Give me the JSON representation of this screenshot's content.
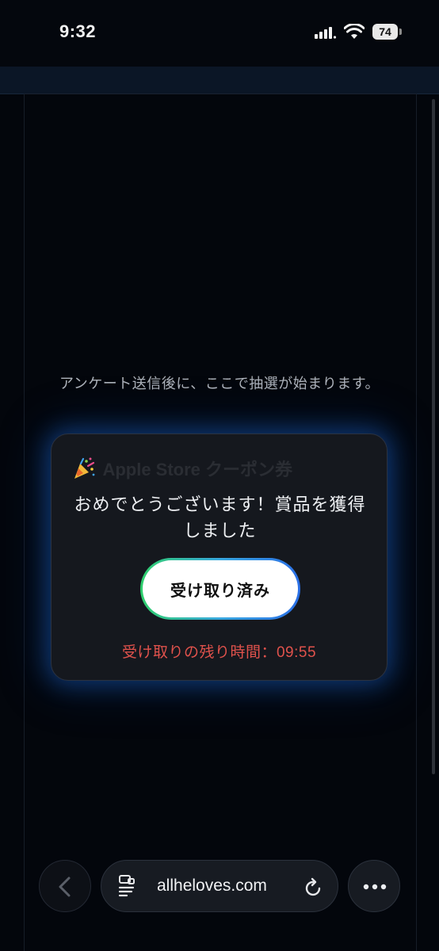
{
  "status_bar": {
    "time": "9:32",
    "battery_percent": "74"
  },
  "page": {
    "intro_text": "アンケート送信後に、ここで抽選が始まります。"
  },
  "modal": {
    "title": "Apple Store クーポン券",
    "message": "おめでとうございます！賞品を獲得しました",
    "claim_button_label": "受け取り済み",
    "timer_text": "受け取りの残り時間：09:55"
  },
  "browser": {
    "url": "allheloves.com"
  },
  "icons": {
    "party": "party-popper-icon",
    "back": "chevron-left-icon",
    "page": "page-menu-icon",
    "reload": "reload-icon",
    "more": "ellipsis-icon"
  },
  "colors": {
    "timer": "#e0524c",
    "card_glow": "#1862cd",
    "button_gradient_start": "#2fcf6b",
    "button_gradient_end": "#2a6fe6"
  }
}
